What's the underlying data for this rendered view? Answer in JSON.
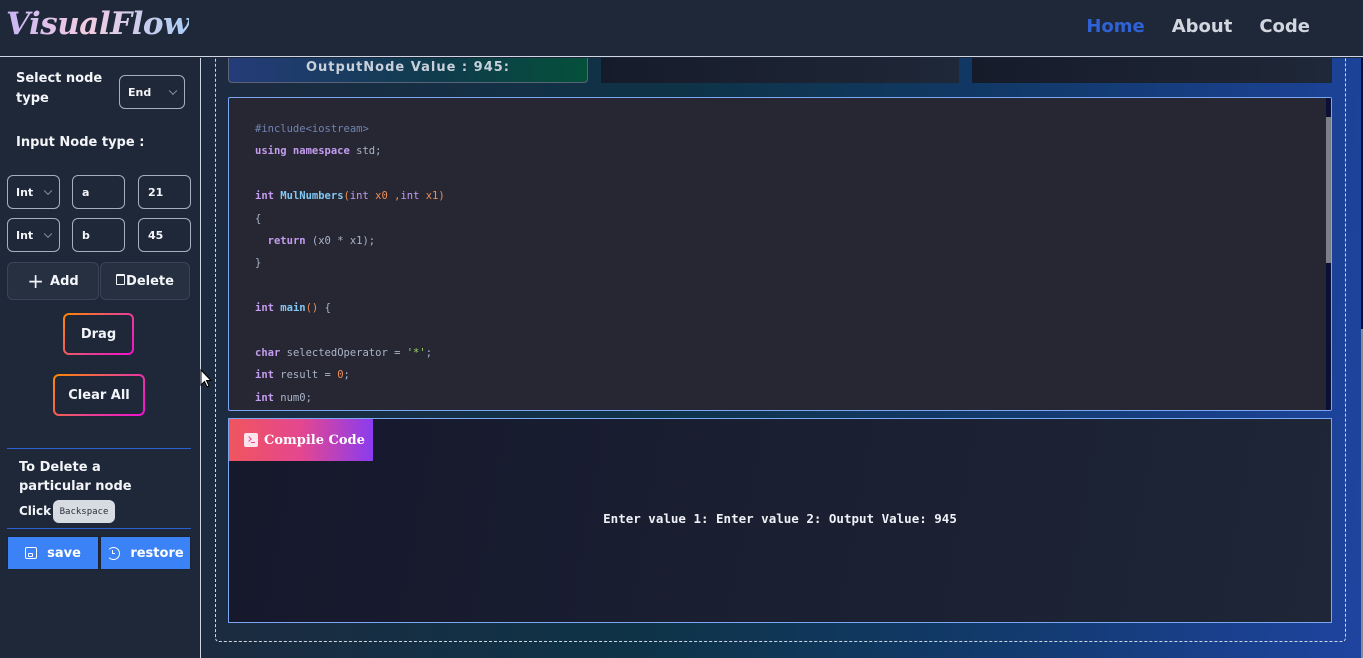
{
  "navbar": {
    "logo": "VisualFlow",
    "links": [
      {
        "label": "Home",
        "active": true
      },
      {
        "label": "About",
        "active": false
      },
      {
        "label": "Code",
        "active": false
      }
    ]
  },
  "sidebar": {
    "select_node_type_label": "Select node type",
    "select_node_type_value": "End",
    "input_node_type_label": "Input Node type :",
    "inputs": [
      {
        "type": "Int",
        "name": "a",
        "value": "21"
      },
      {
        "type": "Int",
        "name": "b",
        "value": "45"
      }
    ],
    "add_label": "Add",
    "delete_label": "Delete",
    "drag_label": "Drag",
    "clear_all_label": "Clear All",
    "delete_hint_title": "To Delete a particular node",
    "delete_hint_click": "Click",
    "delete_hint_key": "Backspace",
    "save_label": "save",
    "restore_label": "restore"
  },
  "canvas": {
    "output_node_text": "OutputNode Value : 945:"
  },
  "code_panel": {
    "lines": [
      "#include<iostream>",
      "using namespace std;",
      "",
      "int MulNumbers(int x0 ,int x1)",
      "{",
      "  return (x0 * x1);",
      "}",
      "",
      "int main() {",
      "",
      "char selectedOperator = '*';",
      "int result = 0;",
      "int num0;"
    ]
  },
  "console": {
    "compile_label": "Compile Code",
    "output": "Enter value 1: Enter value 2: Output Value: 945"
  },
  "colors": {
    "nav_active": "#2f62d6",
    "blue_button": "#3b82f6",
    "panel_border": "#7aa6f2"
  }
}
